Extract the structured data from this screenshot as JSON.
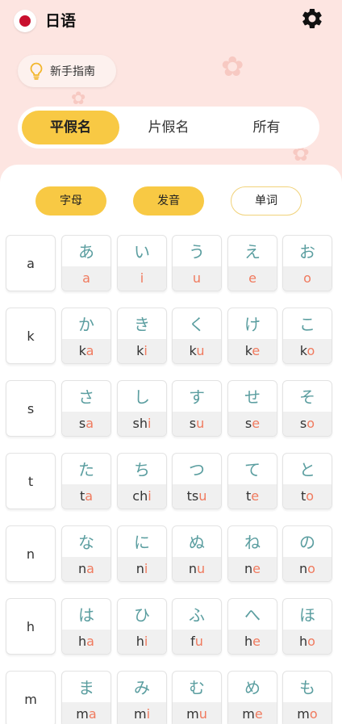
{
  "header": {
    "title": "日语",
    "settings_icon": "gear-icon",
    "flag_icon": "japan-flag-icon"
  },
  "guide": {
    "label": "新手指南",
    "icon": "lightbulb-icon"
  },
  "script_tabs": [
    {
      "label": "平假名",
      "active": true
    },
    {
      "label": "片假名",
      "active": false
    },
    {
      "label": "所有",
      "active": false
    }
  ],
  "view_tabs": [
    {
      "label": "字母",
      "active": true
    },
    {
      "label": "发音",
      "active": true
    },
    {
      "label": "单词",
      "active": false
    }
  ],
  "colors": {
    "accent": "#f8c944",
    "kana": "#5b9ea0",
    "vowel": "#f07a5e",
    "background": "#fde5e1"
  },
  "rows": [
    {
      "label": "a",
      "cells": [
        {
          "kana": "あ",
          "cons": "",
          "vowel": "a"
        },
        {
          "kana": "い",
          "cons": "",
          "vowel": "i"
        },
        {
          "kana": "う",
          "cons": "",
          "vowel": "u"
        },
        {
          "kana": "え",
          "cons": "",
          "vowel": "e"
        },
        {
          "kana": "お",
          "cons": "",
          "vowel": "o"
        }
      ]
    },
    {
      "label": "k",
      "cells": [
        {
          "kana": "か",
          "cons": "k",
          "vowel": "a"
        },
        {
          "kana": "き",
          "cons": "k",
          "vowel": "i"
        },
        {
          "kana": "く",
          "cons": "k",
          "vowel": "u"
        },
        {
          "kana": "け",
          "cons": "k",
          "vowel": "e"
        },
        {
          "kana": "こ",
          "cons": "k",
          "vowel": "o"
        }
      ]
    },
    {
      "label": "s",
      "cells": [
        {
          "kana": "さ",
          "cons": "s",
          "vowel": "a"
        },
        {
          "kana": "し",
          "cons": "sh",
          "vowel": "i"
        },
        {
          "kana": "す",
          "cons": "s",
          "vowel": "u"
        },
        {
          "kana": "せ",
          "cons": "s",
          "vowel": "e"
        },
        {
          "kana": "そ",
          "cons": "s",
          "vowel": "o"
        }
      ]
    },
    {
      "label": "t",
      "cells": [
        {
          "kana": "た",
          "cons": "t",
          "vowel": "a"
        },
        {
          "kana": "ち",
          "cons": "ch",
          "vowel": "i"
        },
        {
          "kana": "つ",
          "cons": "ts",
          "vowel": "u"
        },
        {
          "kana": "て",
          "cons": "t",
          "vowel": "e"
        },
        {
          "kana": "と",
          "cons": "t",
          "vowel": "o"
        }
      ]
    },
    {
      "label": "n",
      "cells": [
        {
          "kana": "な",
          "cons": "n",
          "vowel": "a"
        },
        {
          "kana": "に",
          "cons": "n",
          "vowel": "i"
        },
        {
          "kana": "ぬ",
          "cons": "n",
          "vowel": "u"
        },
        {
          "kana": "ね",
          "cons": "n",
          "vowel": "e"
        },
        {
          "kana": "の",
          "cons": "n",
          "vowel": "o"
        }
      ]
    },
    {
      "label": "h",
      "cells": [
        {
          "kana": "は",
          "cons": "h",
          "vowel": "a"
        },
        {
          "kana": "ひ",
          "cons": "h",
          "vowel": "i"
        },
        {
          "kana": "ふ",
          "cons": "f",
          "vowel": "u"
        },
        {
          "kana": "へ",
          "cons": "h",
          "vowel": "e"
        },
        {
          "kana": "ほ",
          "cons": "h",
          "vowel": "o"
        }
      ]
    },
    {
      "label": "m",
      "cells": [
        {
          "kana": "ま",
          "cons": "m",
          "vowel": "a"
        },
        {
          "kana": "み",
          "cons": "m",
          "vowel": "i"
        },
        {
          "kana": "む",
          "cons": "m",
          "vowel": "u"
        },
        {
          "kana": "め",
          "cons": "m",
          "vowel": "e"
        },
        {
          "kana": "も",
          "cons": "m",
          "vowel": "o"
        }
      ]
    }
  ]
}
